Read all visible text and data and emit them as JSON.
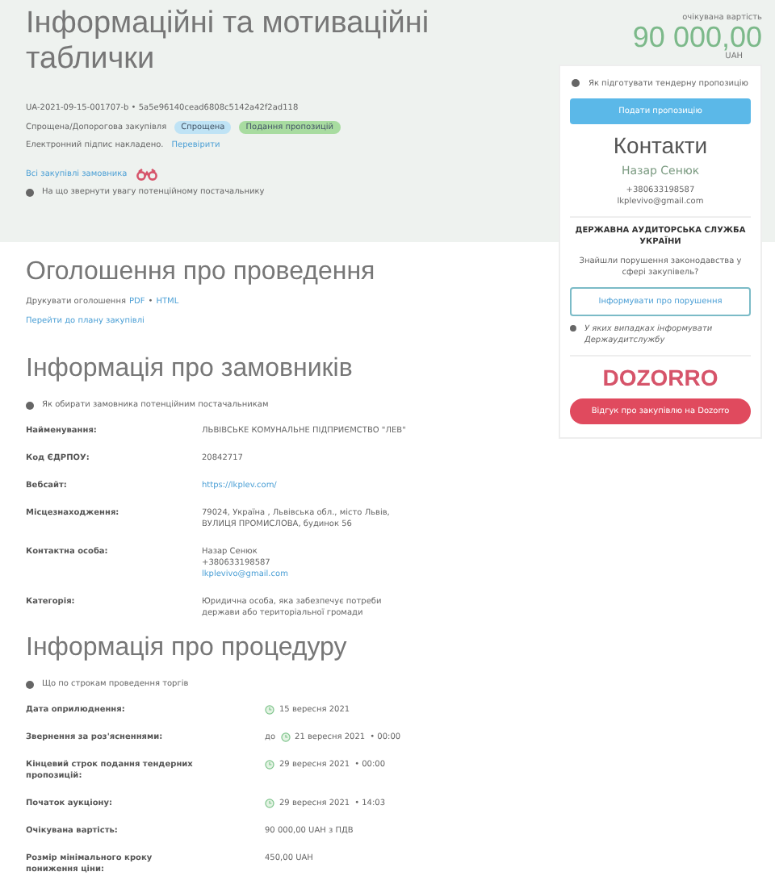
{
  "header": {
    "title": "Інформаційні та мотиваційні таблички",
    "tender_id": "UA-2021-09-15-001707-b • 5a5e96140cead6808c5142a42f2ad118",
    "procedure_type": "Спрощена/Допорогова закупівля",
    "badges": [
      {
        "label": "Спрощена",
        "color": "#bfe3f5"
      },
      {
        "label": "Подання пропозицій",
        "color": "#a8dca0"
      }
    ],
    "signature": {
      "text": "Електронний підпис накладено.",
      "link": "Перевірити"
    },
    "all_link": "Всі закупівлі замовника",
    "notice": "На що звернути увагу потенційному постачальнику"
  },
  "budget": {
    "label": "очікувана вартість",
    "amount": "90 000,00",
    "currency": "UAH"
  },
  "sidebar": {
    "hint": "Як підготувати тендерну пропозицію",
    "submit": "Подати пропозицію",
    "contacts_title": "Контакти",
    "name": "Назар Сенюк",
    "phone": "+380633198587",
    "email": "lkplevivo@gmail.com",
    "audit_title": "ДЕРЖАВНА АУДИТОРСЬКА СЛУЖБА УКРАЇНИ",
    "audit_question": "Знайшли порушення законодавства у сфері закупівель?",
    "audit_button": "Інформувати про порушення",
    "audit_hint": "У яких випадках інформувати Держаудитслужбу",
    "dozorro_logo": "DOZORRO",
    "dozorro_button": "Відгук про закупівлю на Dozorro"
  },
  "announcement": {
    "title": "Оголошення про проведення",
    "print_text": "Друкувати оголошення",
    "pdf": "PDF",
    "separator": "•",
    "html": "HTML",
    "plan_link": "Перейти до плану закупівлі"
  },
  "customers": {
    "title": "Інформація про замовників",
    "notice": "Як обирати замовника потенційним постачальникам",
    "rows": [
      {
        "label": "Найменування:",
        "lines": [
          {
            "text": "ЛЬВІВСЬКЕ КОМУНАЛЬНЕ ПІДПРИЄМСТВО \"ЛЕВ\"",
            "kind": "text"
          }
        ]
      },
      {
        "label": "Код ЄДРПОУ:",
        "lines": [
          {
            "text": "20842717",
            "kind": "text"
          }
        ]
      },
      {
        "label": "Вебсайт:",
        "lines": [
          {
            "text": "https://lkplev.com/",
            "kind": "link"
          }
        ]
      },
      {
        "label": "Місцезнаходження:",
        "lines": [
          {
            "text": "79024, Україна , Львівська обл., місто Львів,",
            "kind": "text"
          },
          {
            "text": "ВУЛИЦЯ ПРОМИСЛОВА, будинок 56",
            "kind": "text"
          }
        ]
      },
      {
        "label": "Контактна особа:",
        "lines": [
          {
            "text": "Назар Сенюк",
            "kind": "text"
          },
          {
            "text": "+380633198587",
            "kind": "text"
          },
          {
            "text": "lkplevivo@gmail.com",
            "kind": "link"
          }
        ]
      },
      {
        "label": "Категорія:",
        "lines": [
          {
            "text": "Юридична особа, яка забезпечує потреби",
            "kind": "text"
          },
          {
            "text": "держави або територіальної громади",
            "kind": "text"
          }
        ]
      }
    ]
  },
  "procedure": {
    "title": "Інформація про процедуру",
    "notice": "Що по строкам проведення торгів",
    "rows": [
      {
        "label": "Дата оприлюднення:",
        "kind": "date",
        "date": "15 вересня 2021"
      },
      {
        "label": "Звернення за роз'ясненнями:",
        "kind": "date",
        "prefix": "до",
        "date": "21 вересня 2021",
        "time": "• 00:00"
      },
      {
        "label": "Кінцевий строк подання тендерних пропозицій:",
        "kind": "date",
        "date": "29 вересня 2021",
        "time": "• 00:00"
      },
      {
        "label": "Початок аукціону:",
        "kind": "date",
        "date": "29 вересня 2021",
        "time": "• 14:03"
      },
      {
        "label": "Очікувана вартість:",
        "kind": "text",
        "value": "90 000,00 UAH з ПДВ"
      },
      {
        "label": "Розмір мінімального кроку пониження ціни:",
        "kind": "text",
        "value": "450,00 UAH"
      }
    ]
  }
}
